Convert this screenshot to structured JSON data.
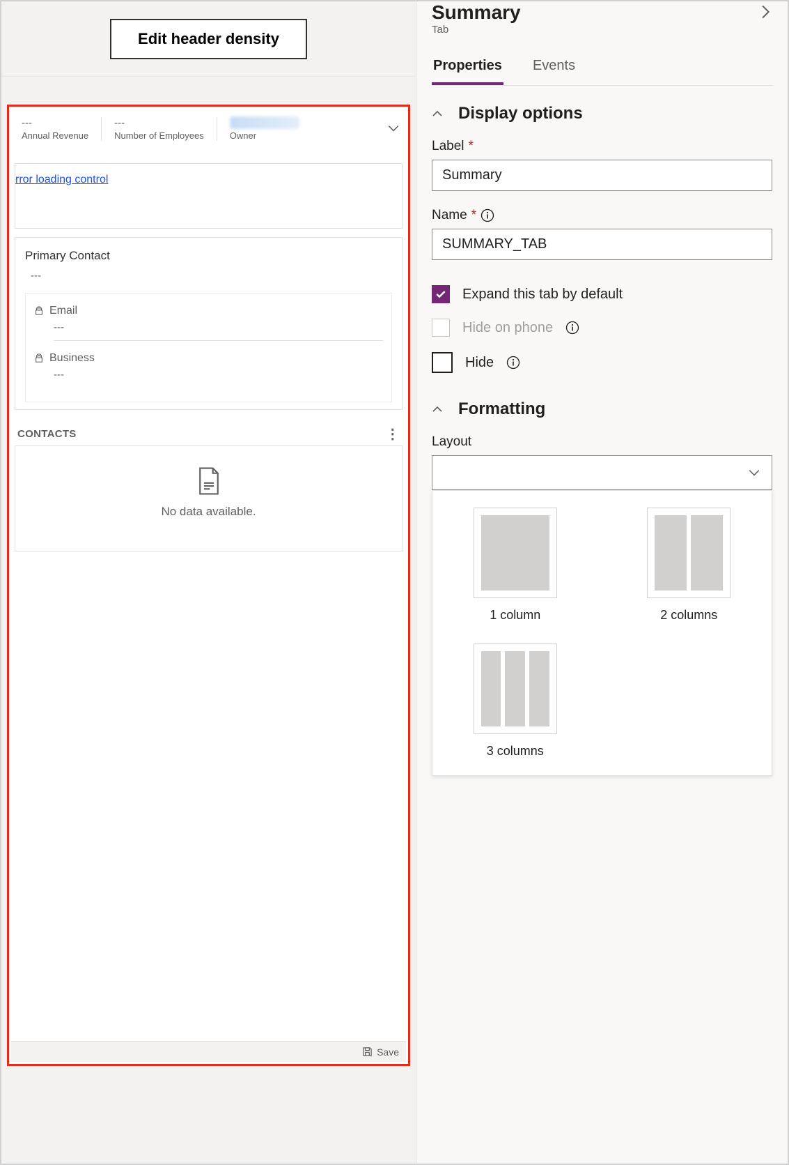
{
  "header": {
    "button_label": "Edit header density"
  },
  "form": {
    "header_fields": [
      {
        "value": "---",
        "label": "Annual Revenue"
      },
      {
        "value": "---",
        "label": "Number of Employees"
      },
      {
        "value": "",
        "label": "Owner"
      }
    ],
    "error_text": "rror loading control",
    "primary_contact": {
      "title": "Primary Contact",
      "value": "---",
      "email_label": "Email",
      "email_value": "---",
      "business_label": "Business",
      "business_value": "---"
    },
    "contacts": {
      "title": "CONTACTS",
      "empty_text": "No data available."
    },
    "save_label": "Save"
  },
  "panel": {
    "title": "Summary",
    "subtitle": "Tab",
    "tabs": {
      "properties": "Properties",
      "events": "Events"
    },
    "display": {
      "section_title": "Display options",
      "label_field": "Label",
      "label_value": "Summary",
      "name_field": "Name",
      "name_value": "SUMMARY_TAB",
      "expand_label": "Expand this tab by default",
      "hide_phone_label": "Hide on phone",
      "hide_label": "Hide"
    },
    "formatting": {
      "section_title": "Formatting",
      "layout_label": "Layout",
      "options": {
        "one": "1 column",
        "two": "2 columns",
        "three": "3 columns"
      }
    }
  }
}
